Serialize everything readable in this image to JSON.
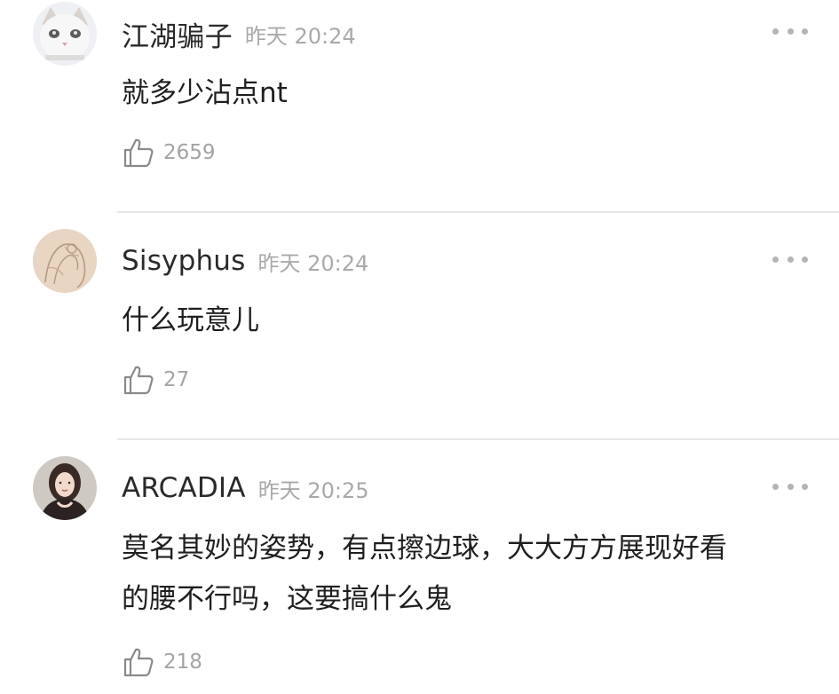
{
  "comments": [
    {
      "username": "江湖骗子",
      "time": "昨天 20:24",
      "text": "就多少沾点nt",
      "likes": "2659",
      "avatar_icon": "white-cat-avatar"
    },
    {
      "username": "Sisyphus",
      "time": "昨天 20:24",
      "text": "什么玩意儿",
      "likes": "27",
      "avatar_icon": "sketch-drawing-avatar"
    },
    {
      "username": "ARCADIA",
      "time": "昨天 20:25",
      "text": "莫名其妙的姿势，有点擦边球，大大方方展现好看\n的腰不行吗，这要搞什么鬼",
      "likes": "218",
      "avatar_icon": "woman-portrait-avatar"
    }
  ],
  "colors": {
    "username": "#2a2a2a",
    "time": "#a9a9a9",
    "text": "#1f1f1f",
    "like_icon": "#8a8a8a",
    "divider": "#e7e7e7"
  }
}
